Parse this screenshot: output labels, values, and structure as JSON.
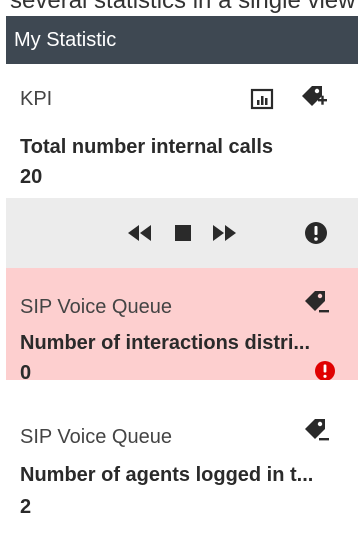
{
  "top_caption": "several statistics in a single view",
  "header": {
    "title": "My Statistic"
  },
  "kpi": {
    "category": "KPI",
    "title": "Total number internal calls",
    "value": "20"
  },
  "controls": {
    "rewind_icon": "rewind-icon",
    "stop_icon": "stop-icon",
    "forward_icon": "fast-forward-icon",
    "alert_icon": "exclamation-circle-icon"
  },
  "queue_alert": {
    "category": "SIP Voice Queue",
    "title": "Number of interactions distri...",
    "value": "0",
    "background": "#fdcfcf",
    "alert_color": "#e00000"
  },
  "queue_agents": {
    "category": "SIP Voice Queue",
    "title": "Number of agents logged in t...",
    "value": "2"
  },
  "colors": {
    "header_bg": "#3e4852",
    "controls_bg": "#ececec",
    "icon": "#2a2a2a"
  }
}
